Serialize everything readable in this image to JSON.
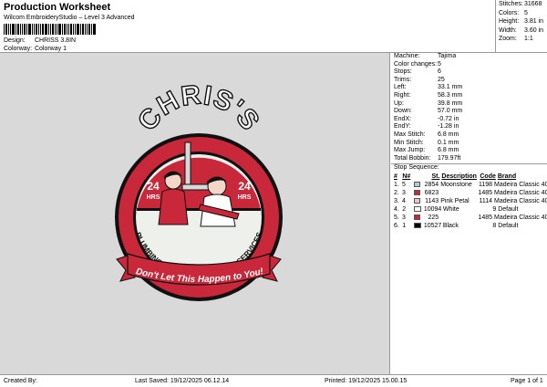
{
  "header": {
    "title": "Production Worksheet",
    "subtitle": "Wilcom EmbroideryStudio – Level 3 Advanced",
    "design_label": "Design:",
    "design_value": "CHRISS 3.8IN",
    "colorway_label": "Colorway:",
    "colorway_value": "Colorway 1"
  },
  "summary": [
    {
      "k": "Stitches:",
      "v": "31668"
    },
    {
      "k": "Colors:",
      "v": "5"
    },
    {
      "k": "Height:",
      "v": "3.81 in"
    },
    {
      "k": "Width:",
      "v": "3.60 in"
    },
    {
      "k": "Zoom:",
      "v": "1:1"
    }
  ],
  "machine_info": [
    {
      "k": "Machine:",
      "v": "Tajima"
    },
    {
      "k": "Color changes:",
      "v": "5"
    },
    {
      "k": "Stops:",
      "v": "6"
    },
    {
      "k": "Trims:",
      "v": "25"
    },
    {
      "k": "Left:",
      "v": "33.1 mm"
    },
    {
      "k": "Right:",
      "v": "58.3 mm"
    },
    {
      "k": "Up:",
      "v": "39.8 mm"
    },
    {
      "k": "Down:",
      "v": "57.0 mm"
    },
    {
      "k": "EndX:",
      "v": "-0.72 in"
    },
    {
      "k": "EndY:",
      "v": "-1.28 in"
    },
    {
      "k": "Max Stitch:",
      "v": "6.8 mm"
    },
    {
      "k": "Min Stitch:",
      "v": "0.1 mm"
    },
    {
      "k": "Max Jump:",
      "v": "6.8 mm"
    },
    {
      "k": "Total Bobbin:",
      "v": "179.97ft"
    }
  ],
  "stop_sequence": {
    "title": "Stop Sequence:",
    "headers": {
      "num": "#",
      "n": "N#",
      "st": "St.",
      "desc": "Description",
      "code": "Code",
      "brand": "Brand"
    },
    "rows": [
      {
        "num": "1.",
        "n": "5",
        "color": "#b7c6dd",
        "st": "2854",
        "desc": "Moonstone",
        "code": "1198",
        "brand": "Madeira Classic 40"
      },
      {
        "num": "2.",
        "n": "3",
        "color": "#c8283a",
        "st": "6823",
        "desc": "",
        "code": "1485",
        "brand": "Madeira Classic 40"
      },
      {
        "num": "3.",
        "n": "4",
        "color": "#f0c5c8",
        "st": "1143",
        "desc": "Pink Petal",
        "code": "1114",
        "brand": "Madeira Classic 40"
      },
      {
        "num": "4.",
        "n": "2",
        "color": "#ffffff",
        "st": "10094",
        "desc": "White",
        "code": "9",
        "brand": "Default"
      },
      {
        "num": "5.",
        "n": "3",
        "color": "#c8283a",
        "st": "225",
        "desc": "",
        "code": "1485",
        "brand": "Madeira Classic 40"
      },
      {
        "num": "6.",
        "n": "1",
        "color": "#000000",
        "st": "10527",
        "desc": "Black",
        "code": "8",
        "brand": "Default"
      }
    ]
  },
  "patch": {
    "name": "CHRIS'S",
    "hours_left": "24",
    "hours_right": "24",
    "hrs": "HRS",
    "arc_text": "PLUMBING & AIR CONDITIONING SERVICES",
    "banner_text": "Don't Let This Happen to You!"
  },
  "colors": {
    "red": "#c8283a",
    "cream": "#eef0ec",
    "black": "#111111",
    "canvas": "#d9d9d9"
  },
  "footer": {
    "created_by": "Created By:",
    "last_saved": "Last Saved: 19/12/2025 06.12.14",
    "printed": "Printed: 19/12/2025 15.00.15",
    "page": "Page 1 of 1"
  }
}
